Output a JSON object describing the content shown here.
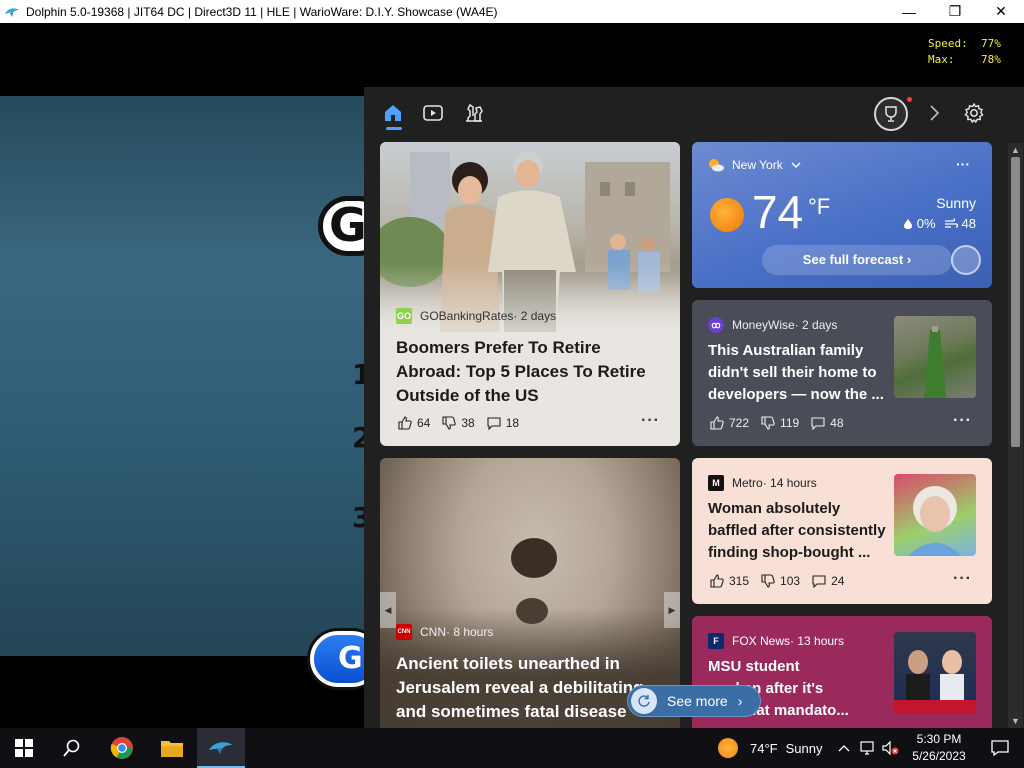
{
  "window": {
    "title": "Dolphin 5.0-19368 | JIT64 DC | Direct3D 11 | HLE | WarioWare: D.I.Y. Showcase (WA4E)",
    "minimize": "—",
    "maximize": "❐",
    "close": "✕"
  },
  "overlay": {
    "speed_line": "Speed:  77%",
    "max_line": "Max:    78%"
  },
  "game": {
    "letter_g": "G",
    "num1": "1",
    "num2": "2",
    "num3": "3",
    "pill_letter": "G"
  },
  "weather": {
    "location": "New York",
    "temperature": "74",
    "unit": "°F",
    "condition": "Sunny",
    "precip": "0%",
    "wind": "48",
    "forecast_label": "See full forecast",
    "more": "···"
  },
  "cards": [
    {
      "source": "GOBankingRates",
      "time": " · 2 days",
      "logo": "GO",
      "headline": "Boomers Prefer To Retire Abroad: Top 5 Places To Retire Outside of the US",
      "likes": "64",
      "dislikes": "38",
      "comments": "18",
      "more": "···"
    },
    {
      "source": "MoneyWise",
      "time": " · 2 days",
      "logo": "ꝏ",
      "headline": "This Australian family didn't sell their home to developers — now the ...",
      "likes": "722",
      "dislikes": "119",
      "comments": "48",
      "more": "···"
    },
    {
      "source": "CNN",
      "time": " · 8 hours",
      "logo": "CNN",
      "headline": "Ancient toilets unearthed in Jerusalem reveal a debilitating and sometimes fatal disease",
      "more": "···"
    },
    {
      "source": "Metro",
      "time": " · 14 hours",
      "logo": "M",
      "headline": "Woman absolutely baffled after consistently finding shop-bought ...",
      "likes": "315",
      "dislikes": "103",
      "comments": "24",
      "more": "···"
    },
    {
      "source": "FOX News",
      "time": " · 13 hours",
      "logo": "F",
      "headline": "MSU student",
      "headline2": "...roken after it's",
      "headline3": "...ed that mandato...",
      "more": "···"
    }
  ],
  "see_more": "See more",
  "taskbar": {
    "weather_temp": "74°F",
    "weather_cond": "Sunny",
    "time": "5:30 PM",
    "date": "5/26/2023"
  },
  "colors": {
    "accent": "#4ea1ff",
    "panel_bg": "#202020",
    "weather_bg": "#4a70c7",
    "metro_bg": "#f9e0d6",
    "fox_bg": "#9a2a5c",
    "overlay_text": "#f4ef3f"
  }
}
